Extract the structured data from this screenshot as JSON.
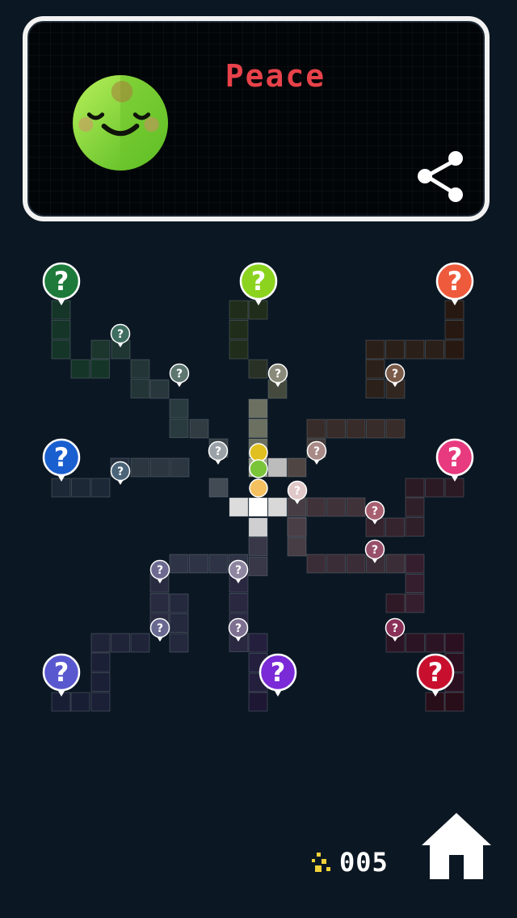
{
  "header": {
    "title": "Peace",
    "title_color": "#e8424a",
    "avatar_icon": "smiling-green-character",
    "share_icon": "share-icon"
  },
  "map": {
    "unknown_marker_glyph": "?",
    "pins": [
      {
        "id": "green-dark",
        "color": "#1d7a3a"
      },
      {
        "id": "lime",
        "color": "#8bd31e"
      },
      {
        "id": "orange",
        "color": "#ee5a3c"
      },
      {
        "id": "blue",
        "color": "#1a5fcf"
      },
      {
        "id": "pink",
        "color": "#e83a7e"
      },
      {
        "id": "indigo",
        "color": "#5a58cf"
      },
      {
        "id": "purple",
        "color": "#7a2ad6"
      },
      {
        "id": "red",
        "color": "#c8102e"
      }
    ]
  },
  "footer": {
    "score": "005",
    "score_icon": "sparkle-stars-icon",
    "home_icon": "home-icon"
  }
}
